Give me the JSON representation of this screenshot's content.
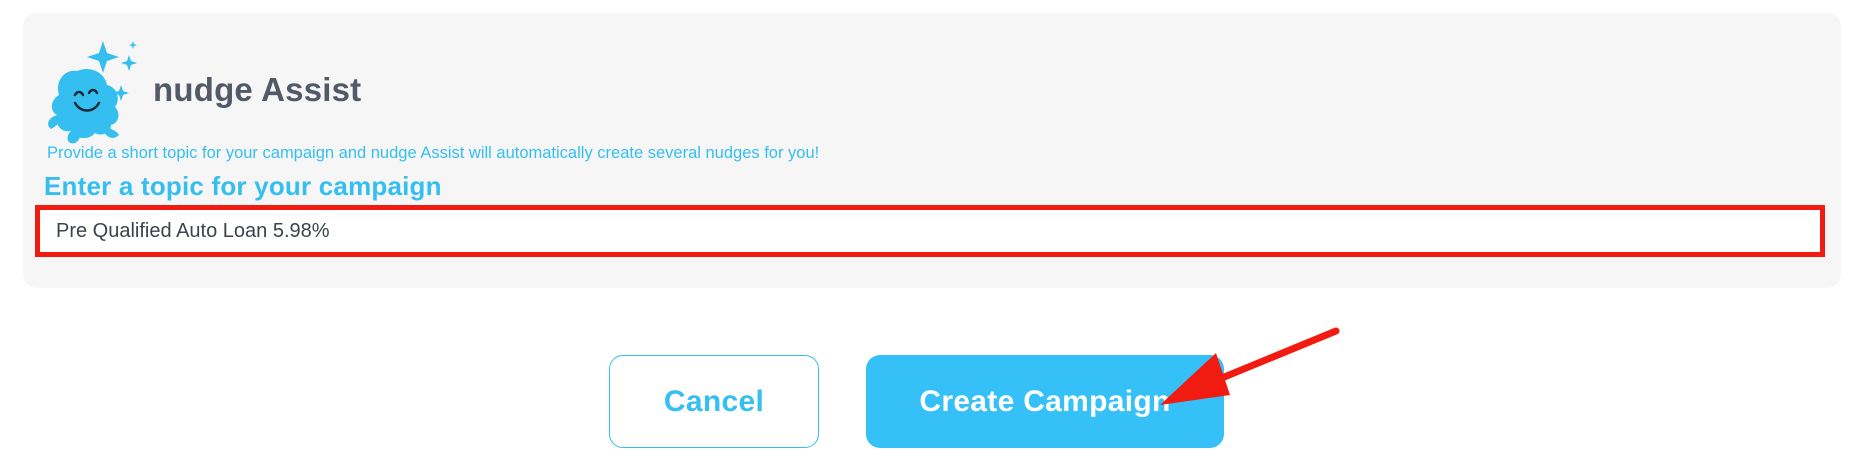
{
  "assist": {
    "title": "nudge Assist",
    "description": "Provide a short topic for your campaign and nudge Assist will automatically create several nudges for you!",
    "field_label": "Enter a topic for your campaign",
    "topic_value": "Pre Qualified Auto Loan 5.98%"
  },
  "actions": {
    "cancel_label": "Cancel",
    "create_label": "Create Campaign"
  },
  "colors": {
    "accent": "#35bff0",
    "title": "#525a67",
    "panel_bg": "#f6f6f6",
    "highlight": "#f21b12"
  },
  "icons": {
    "logo": "nudge-mascot-icon",
    "annotation": "red-arrow-icon"
  }
}
